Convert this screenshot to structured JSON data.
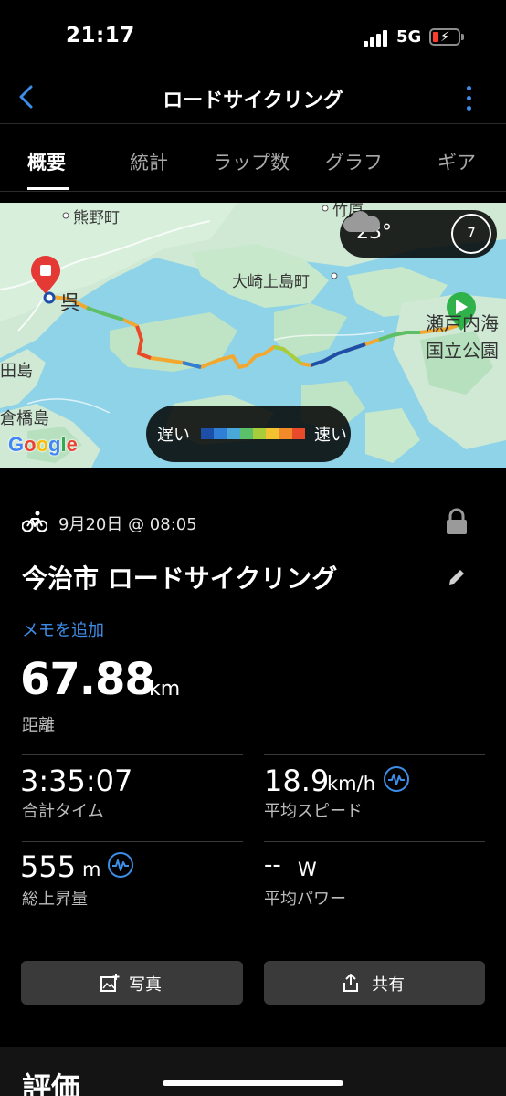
{
  "status_bar": {
    "time": "21:17",
    "network": "5G"
  },
  "nav": {
    "title": "ロードサイクリング",
    "back_icon": "chevron-left-icon",
    "menu_icon": "more-vertical-icon"
  },
  "tabs": [
    {
      "label": "概要",
      "active": true
    },
    {
      "label": "統計",
      "active": false
    },
    {
      "label": "ラップ数",
      "active": false
    },
    {
      "label": "グラフ",
      "active": false
    },
    {
      "label": "ギア",
      "active": false
    }
  ],
  "map": {
    "labels": {
      "kumano": "熊野町",
      "osakikamijima": "大崎上島町",
      "kure": "呉",
      "seto_line1": "瀬戸内海",
      "seto_line2": "国立公園",
      "ta": "田島",
      "kurahashi": "倉橋島",
      "top_right": "竹原"
    },
    "weather": {
      "temperature": "23°",
      "wind": "7",
      "cloud_icon": "cloud-icon"
    },
    "legend": {
      "slow": "遅い",
      "fast": "速い",
      "colors": [
        "#1e4fa8",
        "#2f7fd6",
        "#4aa8d8",
        "#5cc06a",
        "#a8cc3a",
        "#f2c230",
        "#f28a2a",
        "#e84a2a"
      ]
    },
    "google": "Google"
  },
  "activity": {
    "date": "9月20日 @ 08:05",
    "title": "今治市 ロードサイクリング",
    "add_memo": "メモを追加",
    "distance": {
      "value": "67.88",
      "unit": "km",
      "label": "距離"
    }
  },
  "stats": {
    "total_time": {
      "value": "3:35:07",
      "label": "合計タイム"
    },
    "avg_speed": {
      "value": "18.9",
      "unit": "km/h",
      "label": "平均スピード"
    },
    "ascent": {
      "value": "555",
      "unit": "m",
      "label": "総上昇量"
    },
    "avg_power": {
      "value": "--",
      "unit": "W",
      "label": "平均パワー"
    }
  },
  "buttons": {
    "photo": "写真",
    "share": "共有"
  },
  "section": {
    "title": "評価"
  }
}
